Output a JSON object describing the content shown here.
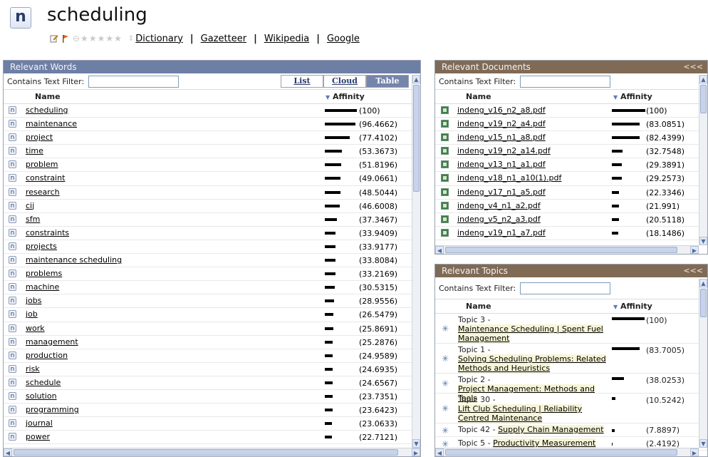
{
  "header": {
    "badge": "n",
    "title": "scheduling",
    "links": [
      "Dictionary",
      "Gazetteer",
      "Wikipedia",
      "Google"
    ],
    "separator": "|"
  },
  "words_panel": {
    "title": "Relevant Words",
    "filter_label": "Contains Text Filter:",
    "filter_value": "",
    "tabs": [
      "List",
      "Cloud",
      "Table"
    ],
    "active_tab": "Table",
    "col_name": "Name",
    "col_affinity": "Affinity",
    "rows": [
      {
        "name": "scheduling",
        "value": "(100)",
        "v": 100
      },
      {
        "name": "maintenance",
        "value": "(96.4662)",
        "v": 96.4662
      },
      {
        "name": "project",
        "value": "(77.4102)",
        "v": 77.4102
      },
      {
        "name": "time",
        "value": "(53.3673)",
        "v": 53.3673
      },
      {
        "name": "problem",
        "value": "(51.8196)",
        "v": 51.8196
      },
      {
        "name": "constraint",
        "value": "(49.0661)",
        "v": 49.0661
      },
      {
        "name": "research",
        "value": "(48.5044)",
        "v": 48.5044
      },
      {
        "name": "cij",
        "value": "(46.6008)",
        "v": 46.6008
      },
      {
        "name": "sfm",
        "value": "(37.3467)",
        "v": 37.3467
      },
      {
        "name": "constraints",
        "value": "(33.9409)",
        "v": 33.9409
      },
      {
        "name": "projects",
        "value": "(33.9177)",
        "v": 33.9177
      },
      {
        "name": "maintenance scheduling",
        "value": "(33.8084)",
        "v": 33.8084
      },
      {
        "name": "problems",
        "value": "(33.2169)",
        "v": 33.2169
      },
      {
        "name": "machine",
        "value": "(30.5315)",
        "v": 30.5315
      },
      {
        "name": "jobs",
        "value": "(28.9556)",
        "v": 28.9556
      },
      {
        "name": "job",
        "value": "(26.5479)",
        "v": 26.5479
      },
      {
        "name": "work",
        "value": "(25.8691)",
        "v": 25.8691
      },
      {
        "name": "management",
        "value": "(25.2876)",
        "v": 25.2876
      },
      {
        "name": "production",
        "value": "(24.9589)",
        "v": 24.9589
      },
      {
        "name": "risk",
        "value": "(24.6935)",
        "v": 24.6935
      },
      {
        "name": "schedule",
        "value": "(24.6567)",
        "v": 24.6567
      },
      {
        "name": "solution",
        "value": "(23.7351)",
        "v": 23.7351
      },
      {
        "name": "programming",
        "value": "(23.6423)",
        "v": 23.6423
      },
      {
        "name": "journal",
        "value": "(23.0633)",
        "v": 23.0633
      },
      {
        "name": "power",
        "value": "(22.7121)",
        "v": 22.7121
      }
    ]
  },
  "docs_panel": {
    "title": "Relevant Documents",
    "collapse": "<<<",
    "filter_label": "Contains Text Filter:",
    "filter_value": "",
    "col_name": "Name",
    "col_affinity": "Affinity",
    "rows": [
      {
        "name": "indeng_v16_n2_a8.pdf",
        "value": "(100)",
        "v": 100
      },
      {
        "name": "indeng_v19_n2_a4.pdf",
        "value": "(83.0851)",
        "v": 83.0851
      },
      {
        "name": "indeng_v15_n1_a8.pdf",
        "value": "(82.4399)",
        "v": 82.4399
      },
      {
        "name": "indeng_v19_n2_a14.pdf",
        "value": "(32.7548)",
        "v": 32.7548
      },
      {
        "name": "indeng_v13_n1_a1.pdf",
        "value": "(29.3891)",
        "v": 29.3891
      },
      {
        "name": "indeng_v18_n1_a10(1).pdf",
        "value": "(29.2573)",
        "v": 29.2573
      },
      {
        "name": "indeng_v17_n1_a5.pdf",
        "value": "(22.3346)",
        "v": 22.3346
      },
      {
        "name": "indeng_v4_n1_a2.pdf",
        "value": "(21.991)",
        "v": 21.991
      },
      {
        "name": "indeng_v5_n2_a3.pdf",
        "value": "(20.5118)",
        "v": 20.5118
      },
      {
        "name": "indeng_v19_n1_a7.pdf",
        "value": "(18.1486)",
        "v": 18.1486
      }
    ]
  },
  "topics_panel": {
    "title": "Relevant Topics",
    "collapse": "<<<",
    "filter_label": "Contains Text Filter:",
    "filter_value": "",
    "col_name": "Name",
    "col_affinity": "Affinity",
    "rows": [
      {
        "prefix": "Topic 3 -",
        "link": "Maintenance Scheduling | Spent Fuel Management",
        "value": "(100)",
        "v": 100,
        "lines": 3
      },
      {
        "prefix": "Topic 1 -",
        "link": "Solving Scheduling Problems: Related Methods and Heuristics",
        "value": "(83.7005)",
        "v": 83.7005,
        "lines": 3
      },
      {
        "prefix": "Topic 2 -",
        "link": "Project Management: Methods and Tools",
        "value": "(38.0253)",
        "v": 38.0253,
        "lines": 2
      },
      {
        "prefix": "Topic 30 -",
        "link": "Lift Club Scheduling | Reliability Centred Maintenance",
        "value": "(10.5242)",
        "v": 10.5242,
        "lines": 3
      },
      {
        "prefix": "Topic 42 -",
        "link": "Supply Chain Management",
        "value": "(7.8897)",
        "v": 7.8897,
        "lines": 1
      },
      {
        "prefix": "Topic 5 -",
        "link": "Productivity Measurement",
        "value": "(2.4192)",
        "v": 2.4192,
        "lines": 1
      }
    ]
  }
}
